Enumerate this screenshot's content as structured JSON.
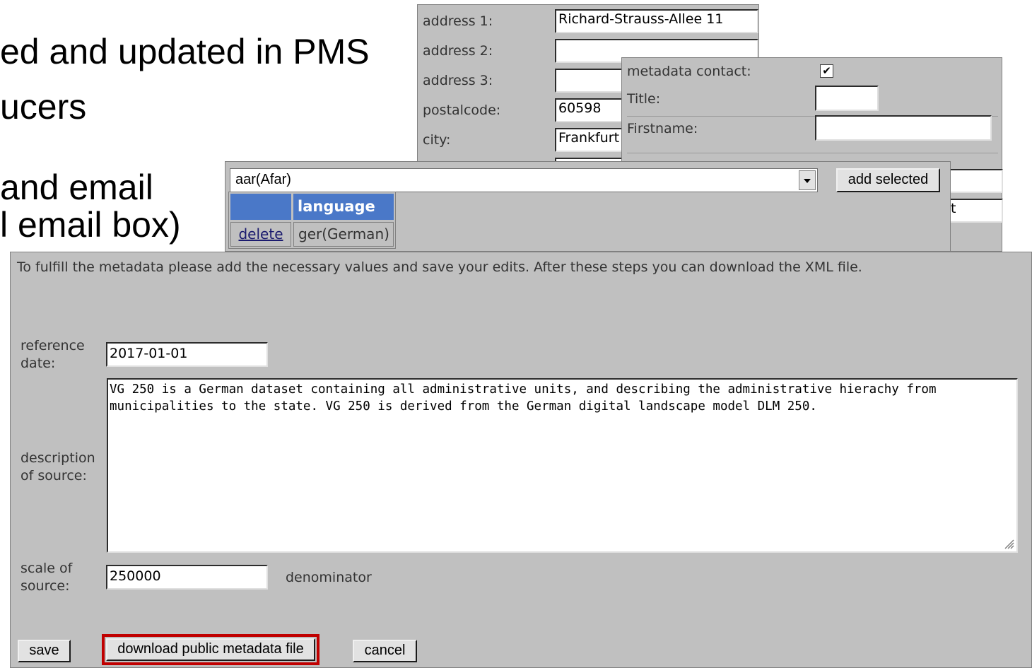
{
  "slide": {
    "lines": [
      "ed and updated in PMS",
      "ucers",
      "and email",
      "l email box)"
    ]
  },
  "contact_form": {
    "address1_label": "address 1:",
    "address1_value": "Richard-Strauss-Allee 11",
    "address2_label": "address 2:",
    "address2_value": "",
    "address3_label": "address 3:",
    "address3_value": "",
    "postalcode_label": "postalcode:",
    "postalcode_value": "60598",
    "city_label": "city:",
    "city_value": "Frankfurt"
  },
  "metadata_contact": {
    "checkbox_label": "metadata contact:",
    "checked": true,
    "check_glyph": "✔",
    "title_label": "Title:",
    "title_value": "",
    "firstname_label": "Firstname:",
    "firstname_value": "",
    "partial_text": "t"
  },
  "language": {
    "select_value": "aar(Afar)",
    "add_button": "add selected",
    "table_header": "language",
    "rows": [
      {
        "action": "delete",
        "value": "ger(German)"
      }
    ]
  },
  "metadata_form": {
    "instructions": "To fulfill the metadata please add the necessary values and save your edits. After these steps you can download the XML file.",
    "reference_date_label": "reference date:",
    "reference_date_value": "2017-01-01",
    "description_label": "description of source:",
    "description_value": "VG 250 is a German dataset containing all administrative units, and describing the administrative hierachy from municipalities to the state. VG 250 is derived from the German digital landscape model DLM 250.",
    "scale_label": "scale of source:",
    "scale_value": "250000",
    "scale_unit": "denominator",
    "save_button": "save",
    "download_button": "download public metadata file",
    "cancel_button": "cancel",
    "highlight_color": "#c00000"
  }
}
